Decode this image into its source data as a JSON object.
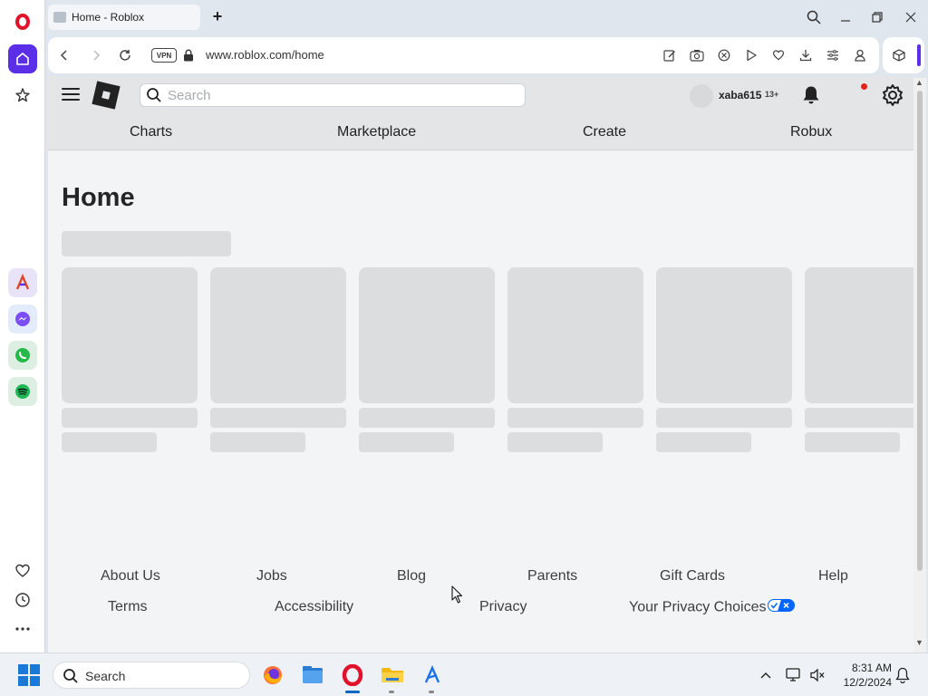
{
  "browser": {
    "tab_title": "Home - Roblox",
    "vpn_label": "VPN",
    "url": "www.roblox.com/home"
  },
  "roblox": {
    "search_placeholder": "Search",
    "username": "xaba615",
    "age_badge": "13+",
    "nav": [
      "Charts",
      "Marketplace",
      "Create",
      "Robux"
    ],
    "page_title": "Home",
    "footer_row1": [
      "About Us",
      "Jobs",
      "Blog",
      "Parents",
      "Gift Cards",
      "Help"
    ],
    "footer_row2": [
      "Terms",
      "Accessibility",
      "Privacy",
      "Your Privacy Choices"
    ]
  },
  "taskbar": {
    "search_label": "Search",
    "time": "8:31 AM",
    "date": "12/2/2024"
  },
  "colors": {
    "opera_red": "#e3122b",
    "opera_accent": "#5b2ee8",
    "notification": "#e2231a",
    "privacy_choice_blue": "#0066ff"
  }
}
